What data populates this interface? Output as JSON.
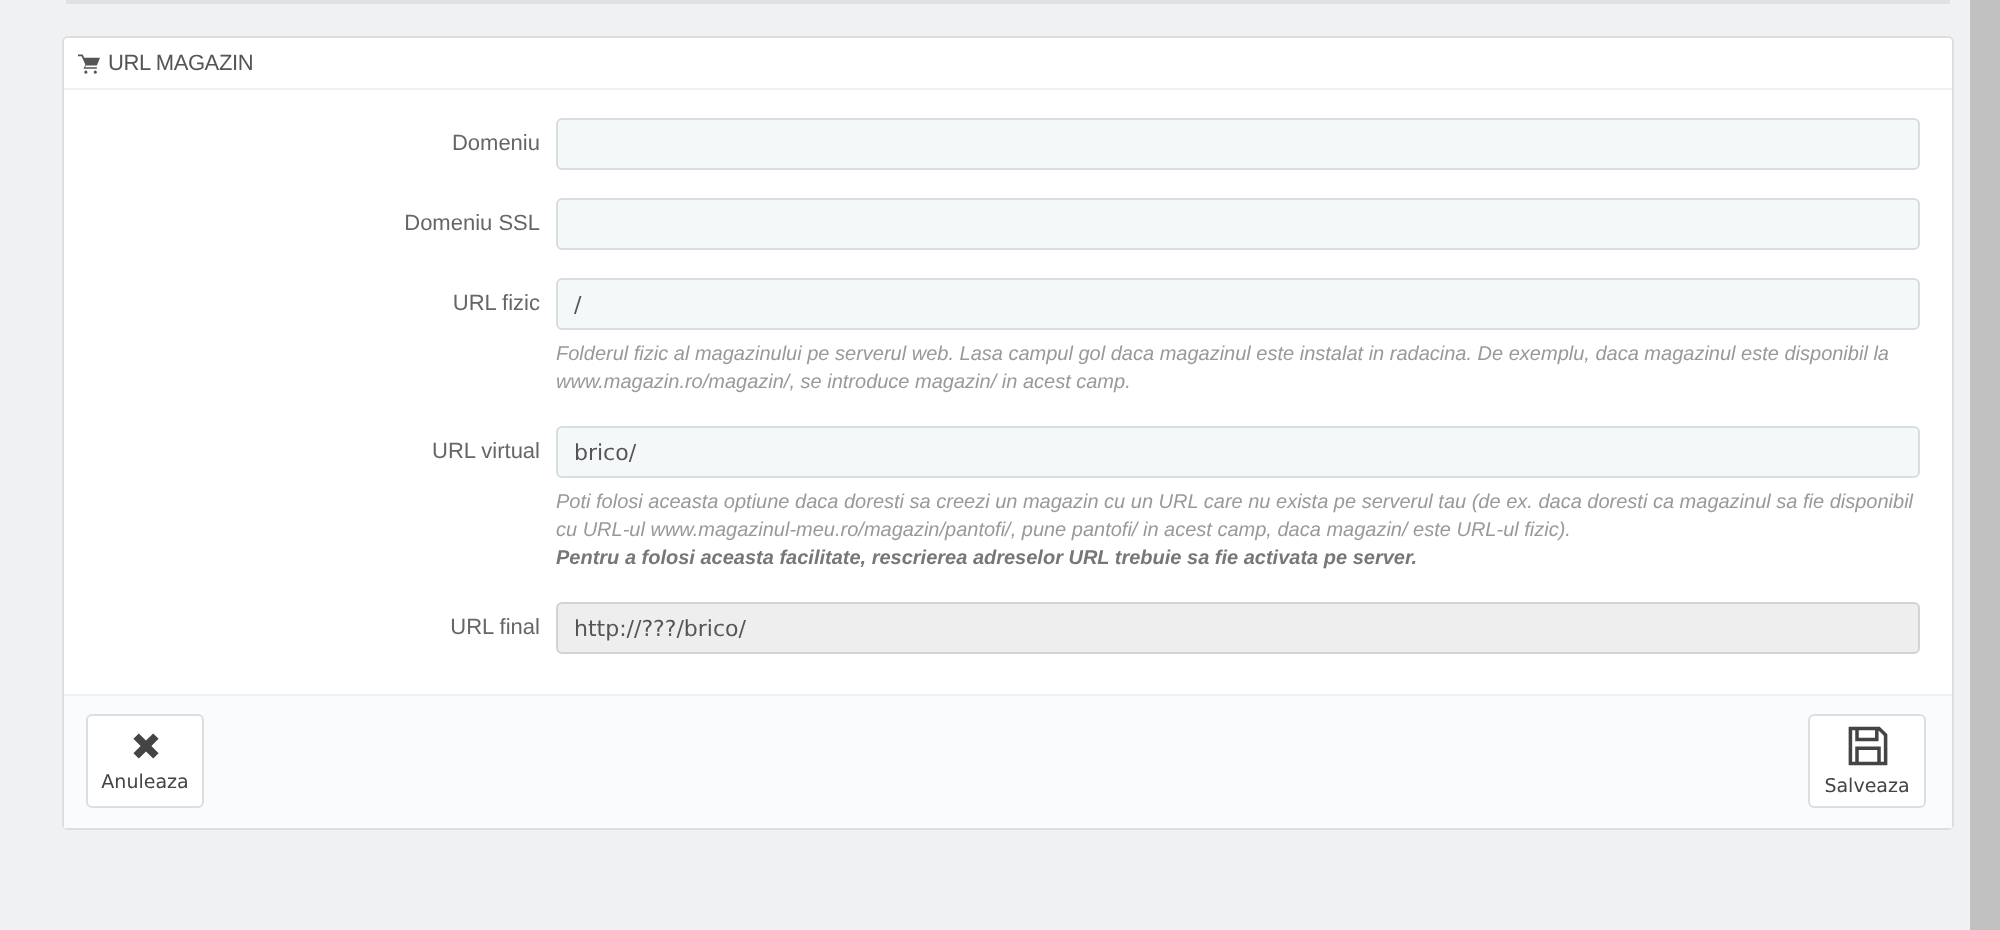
{
  "panel": {
    "title": "URL MAGAZIN"
  },
  "fields": [
    {
      "label": "Domeniu",
      "disabled": false
    },
    {
      "label": "Domeniu SSL",
      "disabled": false
    },
    {
      "label": "URL fizic",
      "value": "/",
      "disabled": false,
      "help": [
        {
          "text": "Folderul fizic al magazinului pe serverul web. Lasa campul gol daca magazinul este instalat in radacina. De exemplu, daca magazinul este disponibil la www.magazin.ro/magazin/, se introduce magazin/ in acest camp.",
          "bold": false
        }
      ]
    },
    {
      "label": "URL virtual",
      "value": "brico/",
      "disabled": false,
      "help": [
        {
          "text": "Poti folosi aceasta optiune daca doresti sa creezi un magazin cu un URL care nu exista pe serverul tau (de ex. daca doresti ca magazinul sa fie disponibil cu URL-ul www.magazinul-meu.ro/magazin/pantofi/, pune pantofi/ in acest camp, daca magazin/ este URL-ul fizic).",
          "bold": false
        },
        {
          "text": "Pentru a folosi aceasta facilitate, rescrierea adreselor URL trebuie sa fie activata pe server.",
          "bold": true
        }
      ]
    },
    {
      "label": "URL final",
      "value": "http://???/brico/",
      "disabled": true
    }
  ],
  "buttons": [
    {
      "label": "Anuleaza",
      "kind": "cancel"
    },
    {
      "label": "Salveaza",
      "kind": "save"
    }
  ]
}
